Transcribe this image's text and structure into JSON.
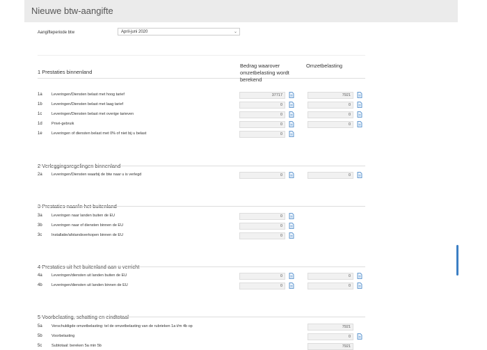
{
  "header": {
    "title": "Nieuwe btw-aangifte"
  },
  "period": {
    "label": "Aangifteperiode btw",
    "value": "April-juni 2020"
  },
  "columns": {
    "amount": "Bedrag waarover omzetbelasting wordt berekend",
    "tax": "Omzetbelasting"
  },
  "sections": [
    {
      "title": "1 Prestaties binnenland"
    },
    {
      "title": "2 Verleggingsregelingen binnenland"
    },
    {
      "title": "3 Prestaties naar/in het buitenland"
    },
    {
      "title": "4 Prestaties uit het buitenland aan u verricht"
    },
    {
      "title": "5 Voorbelasting, schatting en eindtotaal"
    }
  ],
  "rows": [
    {
      "code": "1a",
      "desc": "Leveringen/Diensten belast met hoog tarief",
      "amount": "37717",
      "tax": "7921"
    },
    {
      "code": "1b",
      "desc": "Leveringen/Diensten belast met laag tarief",
      "amount": "0",
      "tax": "0"
    },
    {
      "code": "1c",
      "desc": "Leveringen/Diensten belast met overige tarieven",
      "amount": "0",
      "tax": "0"
    },
    {
      "code": "1d",
      "desc": "Privé-gebruik",
      "amount": "0",
      "tax": "0"
    },
    {
      "code": "1e",
      "desc": "Leveringen of diensten belast met 0% of niet bij u belast",
      "amount": "0"
    },
    {
      "code": "2a",
      "desc": "Leveringen/Diensten waarbij de btw naar u is verlegd",
      "amount": "0",
      "tax": "0"
    },
    {
      "code": "3a",
      "desc": "Leveringen naar landen buiten de EU",
      "amount": "0"
    },
    {
      "code": "3b",
      "desc": "Leveringen naar of diensten binnen de EU",
      "amount": "0"
    },
    {
      "code": "3c",
      "desc": "Installatie/afstandsverkopen binnen de EU",
      "amount": "0"
    },
    {
      "code": "4a",
      "desc": "Leveringen/diensten uit landen buiten de EU",
      "amount": "0",
      "tax": "0"
    },
    {
      "code": "4b",
      "desc": "Leveringen/diensten uit landen binnen de EU",
      "amount": "0",
      "tax": "0"
    },
    {
      "code": "5a",
      "desc": "Verschuldigde omzetbelasting: tel de omzetbelasting van de rubrieken 1a t/m 4b op",
      "tax": "7921"
    },
    {
      "code": "5b",
      "desc": "Voorbelasting",
      "tax": "0"
    },
    {
      "code": "5c",
      "desc": "Subtotaal: bereken 5a min 5b",
      "tax": "7921"
    }
  ]
}
